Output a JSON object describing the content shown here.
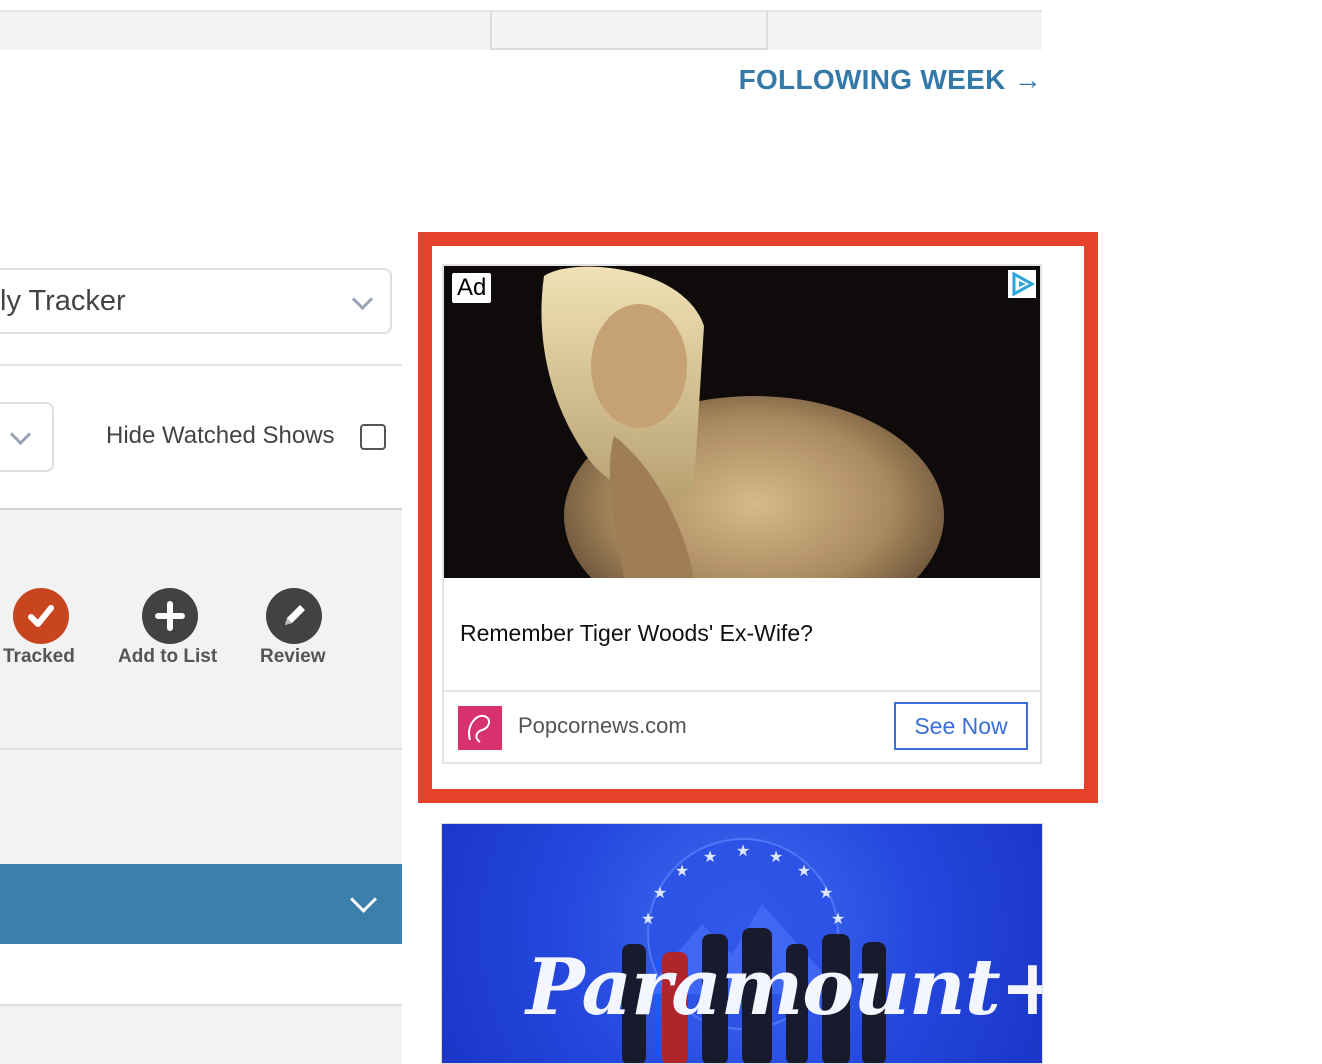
{
  "nav": {
    "following_week": "FOLLOWING WEEK →"
  },
  "filters": {
    "tracker_select_value": "ly Tracker",
    "hide_watched_label": "Hide Watched Shows",
    "hide_watched_checked": false
  },
  "actions": [
    {
      "label": "Tracked",
      "icon": "check-icon",
      "color": "#c8461f"
    },
    {
      "label": "Add to List",
      "icon": "plus-icon",
      "color": "#424242"
    },
    {
      "label": "Review",
      "icon": "pencil-icon",
      "color": "#424242"
    }
  ],
  "ad": {
    "badge": "Ad",
    "headline": "Remember Tiger Woods' Ex-Wife?",
    "source": "Popcornews.com",
    "cta": "See Now",
    "highlight_color": "#e8412b"
  },
  "banner": {
    "brand_text": "Paramount+"
  }
}
